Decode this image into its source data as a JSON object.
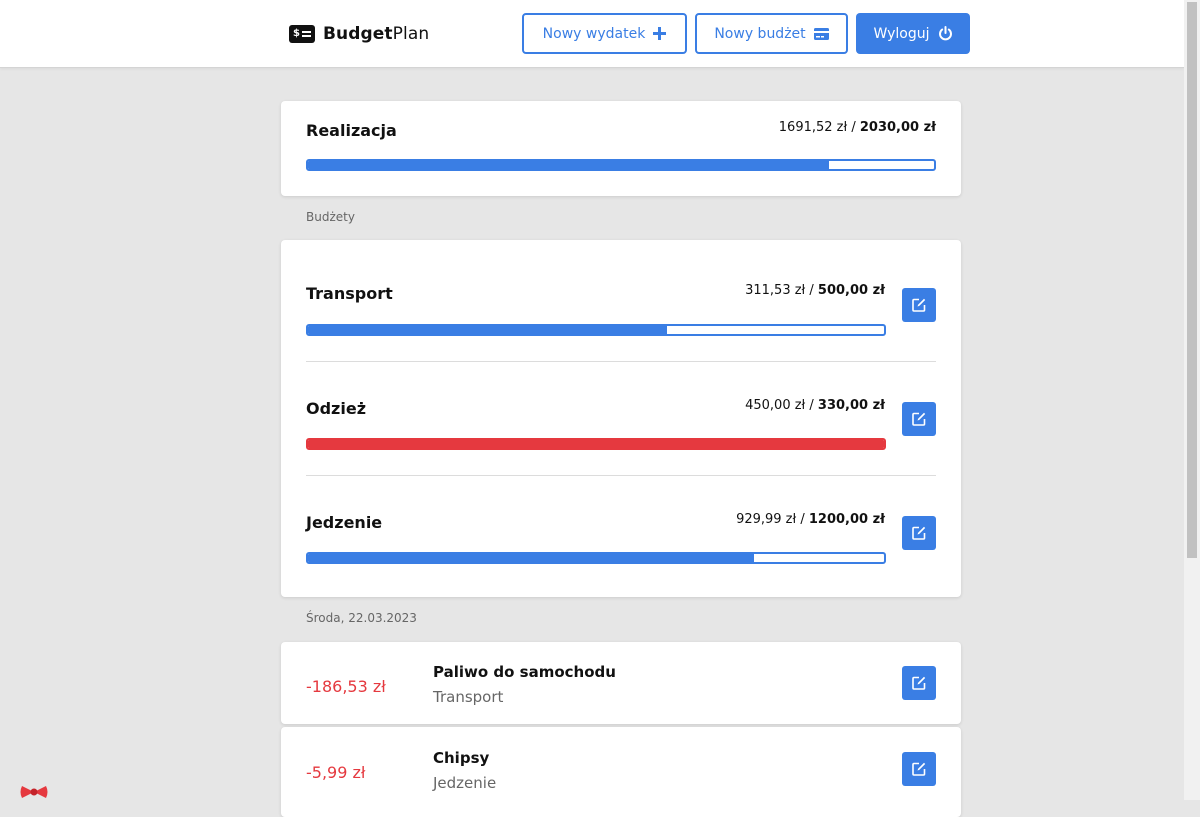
{
  "header": {
    "brand_bold": "Budget",
    "brand_light": "Plan",
    "new_expense_label": "Nowy wydatek",
    "new_budget_label": "Nowy budżet",
    "logout_label": "Wyloguj"
  },
  "summary": {
    "title": "Realizacja",
    "spent": "1691,52 zł",
    "separator": " / ",
    "limit": "2030,00 zł",
    "progress": 0.833
  },
  "budgets_label": "Budżety",
  "budgets": [
    {
      "name": "Transport",
      "spent": "311,53 zł",
      "limit": "500,00 zł",
      "progress": 0.623,
      "over": false
    },
    {
      "name": "Odzież",
      "spent": "450,00 zł",
      "limit": "330,00 zł",
      "progress": 1.0,
      "over": true
    },
    {
      "name": "Jedzenie",
      "spent": "929,99 zł",
      "limit": "1200,00 zł",
      "progress": 0.775,
      "over": false
    }
  ],
  "day_label": "Środa, 22.03.2023",
  "expenses": [
    {
      "amount": "-186,53 zł",
      "name": "Paliwo do samochodu",
      "category": "Transport"
    },
    {
      "amount": "-5,99 zł",
      "name": "Chipsy",
      "category": "Jedzenie"
    }
  ],
  "colors": {
    "accent": "#3a7ee4",
    "danger": "#e5393f",
    "background": "#e6e6e6"
  },
  "icons": {
    "brand": "money-bill-icon",
    "new_expense": "plus-icon",
    "new_budget": "credit-card-icon",
    "logout": "power-icon",
    "edit": "edit-icon"
  }
}
